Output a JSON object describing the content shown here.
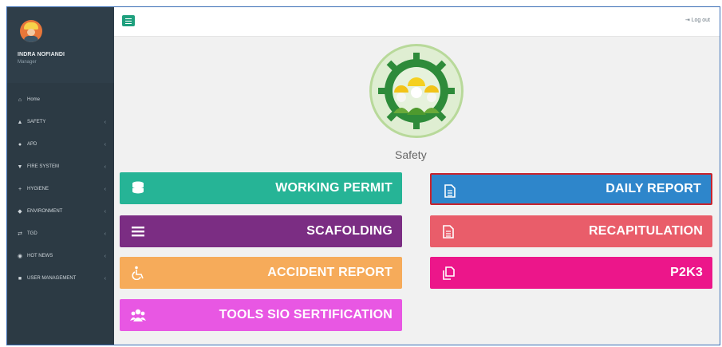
{
  "sidebar": {
    "user_name": "INDRA NOFIANDI",
    "user_role": "Manager",
    "items": [
      {
        "label": "Home",
        "icon": "home-icon",
        "chevron": false
      },
      {
        "label": "SAFETY",
        "icon": "thumbs-up-icon",
        "chevron": true
      },
      {
        "label": "APD",
        "icon": "user-icon",
        "chevron": true
      },
      {
        "label": "FIRE SYSTEM",
        "icon": "fire-extinguisher-icon",
        "chevron": true
      },
      {
        "label": "HYGIENE",
        "icon": "plus-icon",
        "chevron": true
      },
      {
        "label": "ENVIRONMENT",
        "icon": "leaf-icon",
        "chevron": true
      },
      {
        "label": "TGD",
        "icon": "exchange-icon",
        "chevron": true
      },
      {
        "label": "HOT NEWS",
        "icon": "globe-icon",
        "chevron": true
      },
      {
        "label": "USER MANAGEMENT",
        "icon": "lock-icon",
        "chevron": true
      }
    ]
  },
  "topbar": {
    "logout_label": "Log out"
  },
  "main": {
    "section_title": "Safety",
    "buttons": {
      "working_permit": "WORKING PERMIT",
      "daily_report": "DAILY REPORT",
      "scafolding": "SCAFOLDING",
      "recapitulation": "RECAPITULATION",
      "accident_report": "ACCIDENT REPORT",
      "p2k3": "P2K3",
      "tools_sio": "TOOLS SIO SERTIFICATION"
    }
  },
  "colors": {
    "sidebar_bg": "#2c3a44",
    "working_permit": "#26b496",
    "daily_report": "#2e86cb",
    "daily_report_border": "#c8232c",
    "scafolding": "#7b2d83",
    "recapitulation": "#e95d6a",
    "accident_report": "#f6ab5a",
    "p2k3": "#ec168a",
    "tools_sio": "#e857e3"
  }
}
